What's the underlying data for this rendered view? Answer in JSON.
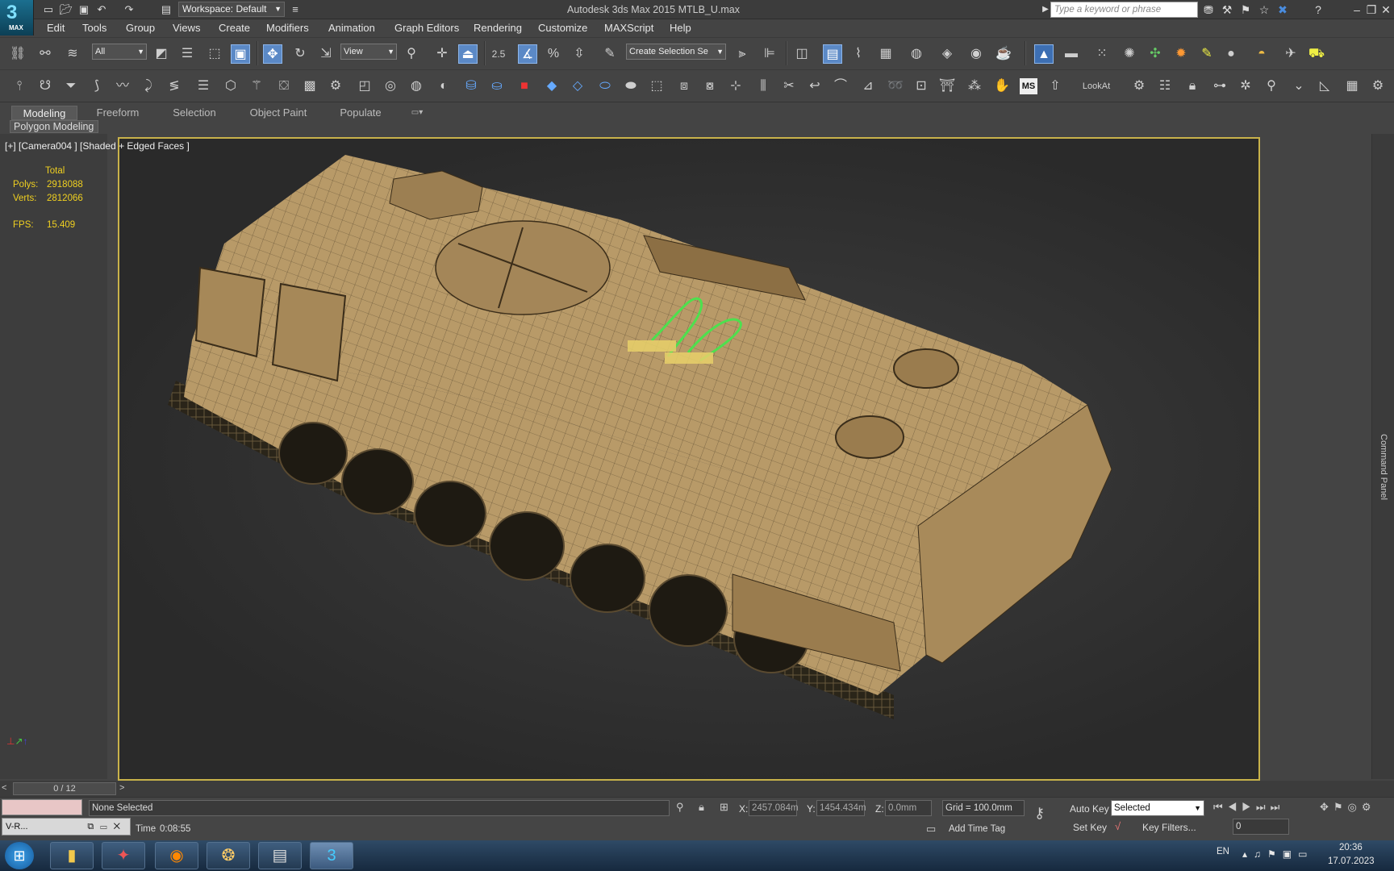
{
  "titlebar": {
    "title": "Autodesk 3ds Max  2015     MTLB_U.max",
    "workspace": "Workspace: Default",
    "search_placeholder": "Type a keyword or phrase",
    "logo_text": "MAX"
  },
  "menu": [
    "Edit",
    "Tools",
    "Group",
    "Views",
    "Create",
    "Modifiers",
    "Animation",
    "Graph Editors",
    "Rendering",
    "Customize",
    "MAXScript",
    "Help"
  ],
  "toolbar": {
    "selection_filter": "All",
    "ref_coord": "View",
    "named_selection": "Create Selection Se",
    "snap_value": "2.5"
  },
  "toolbar2": {
    "lookat": "LookAt",
    "ms_label": "MS"
  },
  "ribbon": {
    "tabs": [
      "Modeling",
      "Freeform",
      "Selection",
      "Object Paint",
      "Populate"
    ],
    "active_tab": "Modeling",
    "panel_label": "Polygon Modeling"
  },
  "viewport": {
    "label": "[+] [Camera004 ] [Shaded + Edged Faces ]",
    "stats_total": "Total",
    "polys_label": "Polys:",
    "polys_value": "2918088",
    "verts_label": "Verts:",
    "verts_value": "2812066",
    "fps_label": "FPS:",
    "fps_value": "15.409"
  },
  "command_panel": "Command Panel",
  "timeline": {
    "frame": "0 / 12"
  },
  "status": {
    "selection": "None Selected",
    "x_label": "X:",
    "x_value": "2457.084m",
    "y_label": "Y:",
    "y_value": "1454.434m",
    "z_label": "Z:",
    "z_value": "0.0mm",
    "grid": "Grid = 100.0mm",
    "auto_key": "Auto Key",
    "set_key": "Set Key",
    "key_mode": "Selected",
    "key_filters": "Key Filters...",
    "time_label": "Time",
    "time_value": "0:08:55",
    "add_time_tag": "Add Time Tag",
    "frame_value": "0",
    "vray_label": "V-R..."
  },
  "taskbar": {
    "lang": "EN",
    "time": "20:36",
    "date": "17.07.2023"
  },
  "colors": {
    "viewport_border": "#c8b24a",
    "stat_text": "#f0d020",
    "selection_green": "#4ee04e",
    "model_tan": "#b89a68"
  }
}
